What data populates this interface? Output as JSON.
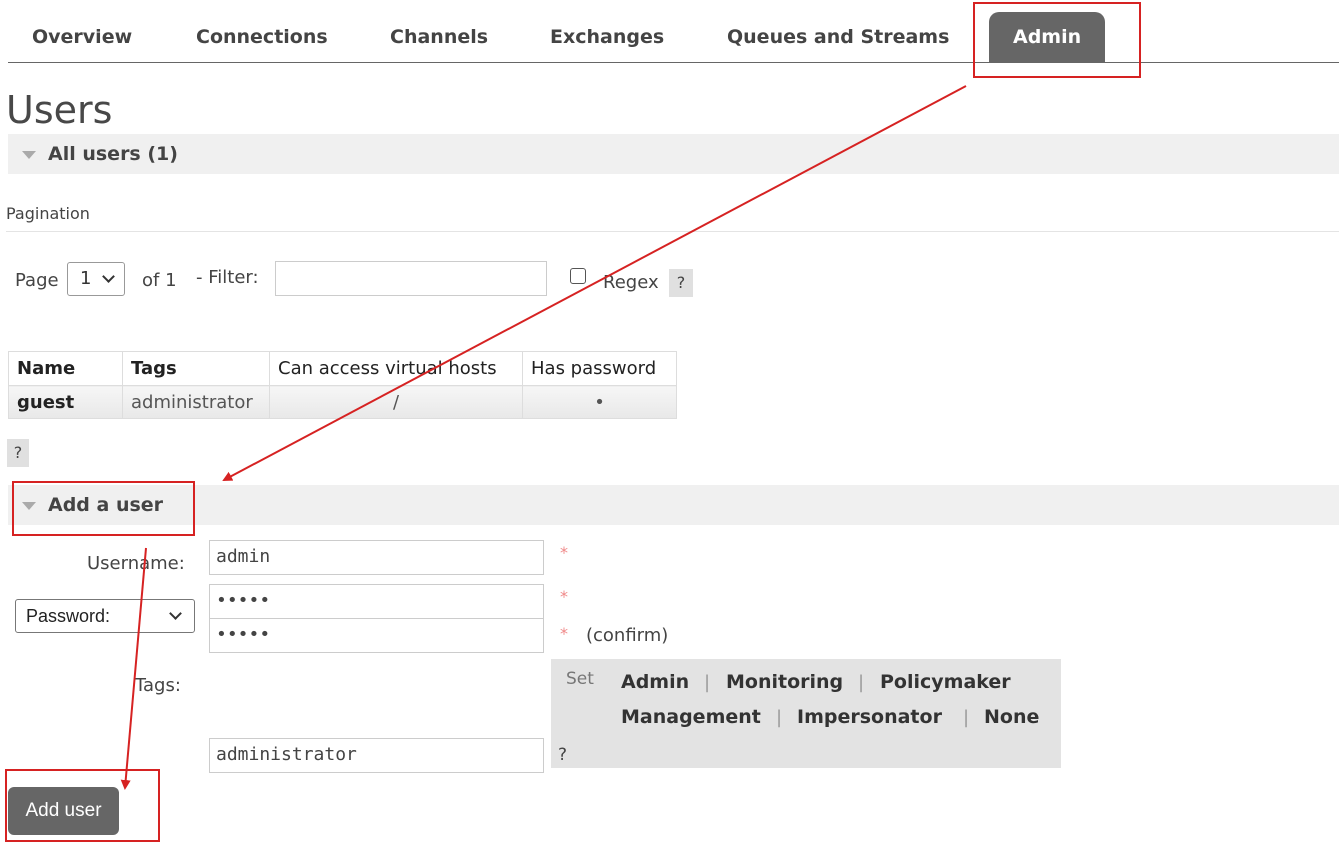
{
  "nav": {
    "tabs": [
      {
        "label": "Overview"
      },
      {
        "label": "Connections"
      },
      {
        "label": "Channels"
      },
      {
        "label": "Exchanges"
      },
      {
        "label": "Queues and Streams"
      },
      {
        "label": "Admin",
        "active": true
      }
    ]
  },
  "page": {
    "title": "Users"
  },
  "all_users": {
    "heading": "All users (1)",
    "pagination_label": "Pagination",
    "page_label": "Page",
    "page_value": "1",
    "of_label": "of 1",
    "filter_label": "- Filter:",
    "filter_value": "",
    "regex_label": "Regex",
    "regex_checked": false,
    "help": "?",
    "table": {
      "headers": [
        "Name",
        "Tags",
        "Can access virtual hosts",
        "Has password"
      ],
      "rows": [
        {
          "name": "guest",
          "tags": "administrator",
          "vhosts": "/",
          "has_password": "•"
        }
      ]
    },
    "table_help": "?"
  },
  "add_user": {
    "heading": "Add a user",
    "username_label": "Username:",
    "username_value": "admin",
    "required_mark": "*",
    "password_mode": "Password:",
    "password_value": "•••••",
    "confirm_value": "•••••",
    "confirm_label": "(confirm)",
    "tags_label": "Tags:",
    "tags_value": "administrator",
    "tags_help": "?",
    "set_label": "Set",
    "tag_options": [
      "Admin",
      "Monitoring",
      "Policymaker",
      "Management",
      "Impersonator",
      "None"
    ],
    "separator": "|",
    "submit_label": "Add user"
  },
  "annotation_color": "#d62222"
}
